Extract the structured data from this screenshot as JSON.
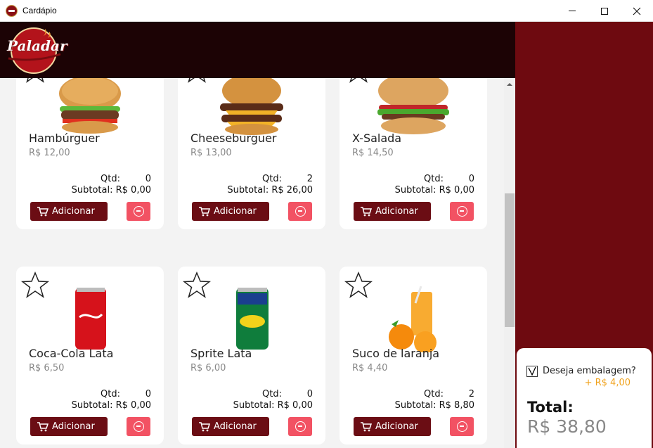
{
  "window": {
    "title": "Cardápio",
    "controls": {
      "minimize": "minimize-icon",
      "maximize": "maximize-icon",
      "close": "close-icon"
    }
  },
  "header": {
    "logo_text": "Paladar"
  },
  "labels": {
    "qty": "Qtd:",
    "subtotal_prefix": "Subtotal:",
    "add_button": "Adicionar"
  },
  "products": [
    {
      "name": "Hambúrguer",
      "price": "R$ 12,00",
      "qty": "0",
      "subtotal": "R$ 0,00",
      "image": "hamburger-image"
    },
    {
      "name": "Cheeseburguer",
      "price": "R$ 13,00",
      "qty": "2",
      "subtotal": "R$ 26,00",
      "image": "cheeseburger-image"
    },
    {
      "name": "X-Salada",
      "price": "R$ 14,50",
      "qty": "0",
      "subtotal": "R$ 0,00",
      "image": "x-salada-image"
    },
    {
      "name": "Coca-Cola Lata",
      "price": "R$ 6,50",
      "qty": "0",
      "subtotal": "R$ 0,00",
      "image": "coca-cola-can-image"
    },
    {
      "name": "Sprite Lata",
      "price": "R$ 6,00",
      "qty": "0",
      "subtotal": "R$ 0,00",
      "image": "sprite-can-image"
    },
    {
      "name": "Suco de laranja",
      "price": "R$ 4,40",
      "qty": "2",
      "subtotal": "R$ 8,80",
      "image": "orange-juice-image"
    }
  ],
  "summary": {
    "packaging_checked": true,
    "packaging_label": "Deseja embalagem?",
    "packaging_price": "+ R$ 4,00",
    "total_label": "Total:",
    "total_value": "R$ 38,80"
  },
  "colors": {
    "header_bg": "#1c0305",
    "side_panel": "#6e0a10",
    "add_button": "#6b0d14",
    "remove_button": "#f25263",
    "packaging_price": "#f0a21c"
  }
}
